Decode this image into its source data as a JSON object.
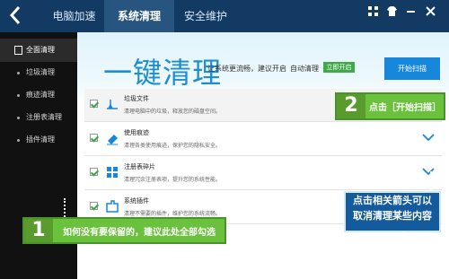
{
  "top_nav": {
    "tab1": "电脑加速",
    "tab2": "系统清理",
    "tab3": "安全维护"
  },
  "sidebar": {
    "items": [
      "全面清理",
      "垃圾清理",
      "痕迹清理",
      "注册表清理",
      "插件清理"
    ]
  },
  "main": {
    "heading": "一键清理",
    "subtext": "让系统更流畅，建议开启",
    "auto_label": "自动清理",
    "enable_button": "立即开启",
    "scan_button": "开始扫描"
  },
  "rows": [
    {
      "title": "垃圾文件",
      "desc": "清理电脑中的垃圾，释放您的磁盘空间。"
    },
    {
      "title": "使用痕迹",
      "desc": "清理各类使用痕迹，保护您的隐私安全。"
    },
    {
      "title": "注册表碎片",
      "desc": "清理冗余注册表项，提升您的系统性能。"
    },
    {
      "title": "系统插件",
      "desc": "清理不需要的插件，维护您的系统流畅。"
    }
  ],
  "callout1": {
    "number": "1",
    "text": "如何没有要保留的，建议此处全部勾选"
  },
  "callout2": {
    "number": "2",
    "text": "点击［开始扫描］"
  },
  "note": {
    "line1": "点击相关箭头可以",
    "line2": "取消清理某些内容"
  },
  "colors": {
    "accent": "#1687db",
    "callout": "#69c13c"
  }
}
